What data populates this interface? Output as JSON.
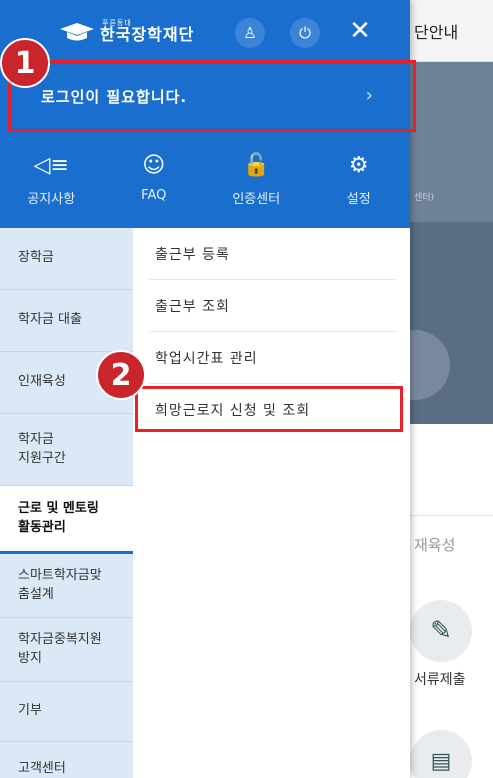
{
  "header": {
    "logo_small": "푸른등대",
    "logo_name": "한국장학재단",
    "login_prompt": "로그인이 필요합니다.",
    "login_chevron": "›",
    "bell_icon": "♙",
    "power_icon": "⏻",
    "close_icon": "✕"
  },
  "quick_links": [
    {
      "icon": "◁≡",
      "label": "공지사항"
    },
    {
      "icon": "☺",
      "label": "FAQ"
    },
    {
      "icon": "🔓",
      "label": "인증센터"
    },
    {
      "icon": "⚙",
      "label": "설정"
    }
  ],
  "sidebar": {
    "items": [
      {
        "label": "장학금"
      },
      {
        "label": "학자금 대출"
      },
      {
        "label": "인재육성"
      },
      {
        "label": "학자금\n지원구간"
      },
      {
        "label": "근로 및 멘토링\n활동관리"
      },
      {
        "label": "스마트학자금맞\n춤설계"
      },
      {
        "label": "학자금중복지원\n방지"
      },
      {
        "label": "기부"
      },
      {
        "label": "고객센터"
      }
    ]
  },
  "submenu": {
    "items": [
      {
        "label": "출근부 등록"
      },
      {
        "label": "출근부 조회"
      },
      {
        "label": "학업시간표 관리"
      },
      {
        "label": "희망근로지 신청 및 조회"
      }
    ]
  },
  "annotations": {
    "badge1": "1",
    "badge2": "2"
  },
  "background_page": {
    "top_text": "단안내",
    "hero_text": "센터)",
    "section_label": "재육성",
    "doc_label": "서류제출"
  },
  "colors": {
    "brand_blue": "#1a6fce",
    "sidebar_bg": "#dbe9f6",
    "highlight_red": "#e8202a",
    "badge_red": "#c8262c"
  }
}
